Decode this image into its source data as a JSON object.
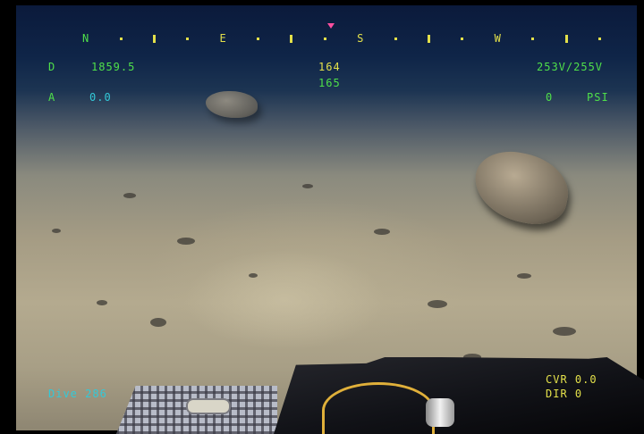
{
  "overlay": {
    "compass_letters": [
      "N",
      "E",
      "S",
      "W"
    ],
    "depth": {
      "label": "D",
      "value": "1859.5"
    },
    "altitude": {
      "label": "A",
      "value": "0.0"
    },
    "heading_primary": "164",
    "heading_secondary": "165",
    "voltage": "253V/255V",
    "pressure": {
      "value": "0",
      "unit": "PSI"
    },
    "dive": "Dive 286",
    "cvr": "CVR 0.0",
    "dir": "DIR 0"
  },
  "colors": {
    "hud_green": "#4fe04a",
    "hud_cyan": "#33c9d8",
    "hud_yellow": "#e3e04a",
    "heading_marker": "#ff4fa0"
  }
}
